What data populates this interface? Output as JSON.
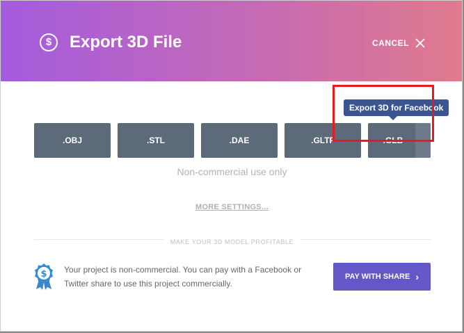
{
  "dialog": {
    "title": "Export 3D File",
    "header_icon": "dollar-circle-icon",
    "cancel_label": "CANCEL",
    "cancel_icon": "close-icon",
    "header_gradient": [
      "#a45cde",
      "#e07a8d"
    ]
  },
  "formats": [
    {
      "label": ".OBJ"
    },
    {
      "label": ".STL"
    },
    {
      "label": ".DAE"
    },
    {
      "label": ".GLTF"
    },
    {
      "label": ".GLB"
    }
  ],
  "tooltip": {
    "text": "Export 3D for Facebook"
  },
  "note": "Non-commercial use only",
  "more_settings": "MORE SETTINGS...",
  "divider_label": "MAKE YOUR 3D MODEL PROFITABLE",
  "promo": {
    "badge_icon": "dollar-badge-icon",
    "text": "Your project is non-commercial. You can pay with a Facebook or Twitter share to use this project commercially.",
    "button_label": "PAY WITH SHARE",
    "button_icon": "chevron-right-icon"
  },
  "colors": {
    "format_button": "#5d6a7a",
    "tooltip": "#3b5590",
    "pay_button": "#6457c8",
    "highlight": "#e8191f"
  }
}
